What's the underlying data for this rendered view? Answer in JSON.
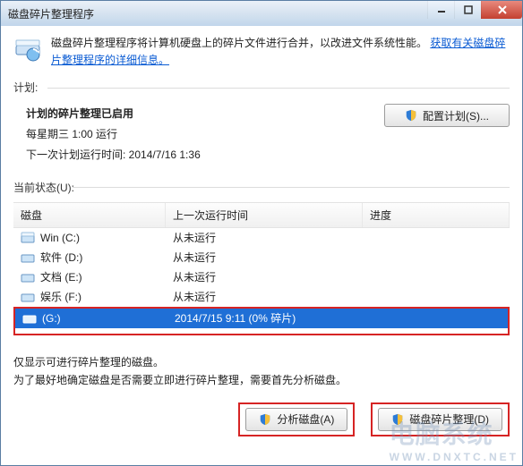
{
  "window": {
    "title": "磁盘碎片整理程序"
  },
  "banner": {
    "text_prefix": "磁盘碎片整理程序将计算机硬盘上的碎片文件进行合并，以改进文件系统性能。",
    "link_text": "获取有关磁盘碎片整理程序的详细信息。"
  },
  "sections": {
    "schedule_label": "计划:",
    "status_label": "当前状态(U):"
  },
  "schedule": {
    "heading": "计划的碎片整理已启用",
    "line1": "每星期三  1:00 运行",
    "line2": "下一次计划运行时间: 2014/7/16 1:36",
    "config_button": "配置计划(S)..."
  },
  "table": {
    "headers": {
      "disk": "磁盘",
      "last": "上一次运行时间",
      "progress": "进度"
    },
    "rows": [
      {
        "name": "Win (C:)",
        "last": "从未运行",
        "progress": ""
      },
      {
        "name": "软件 (D:)",
        "last": "从未运行",
        "progress": ""
      },
      {
        "name": "文档 (E:)",
        "last": "从未运行",
        "progress": ""
      },
      {
        "name": "娱乐 (F:)",
        "last": "从未运行",
        "progress": ""
      }
    ],
    "selected_row": {
      "name": "(G:)",
      "last": "2014/7/15 9:11 (0% 碎片)",
      "progress": ""
    }
  },
  "footer": {
    "note1": "仅显示可进行碎片整理的磁盘。",
    "note2": "为了最好地确定磁盘是否需要立即进行碎片整理，需要首先分析磁盘。",
    "analyze_button": "分析磁盘(A)",
    "defrag_button": "磁盘碎片整理(D)"
  },
  "watermark": {
    "big": "电脑系统",
    "small": "WWW.DNXTC.NET"
  }
}
